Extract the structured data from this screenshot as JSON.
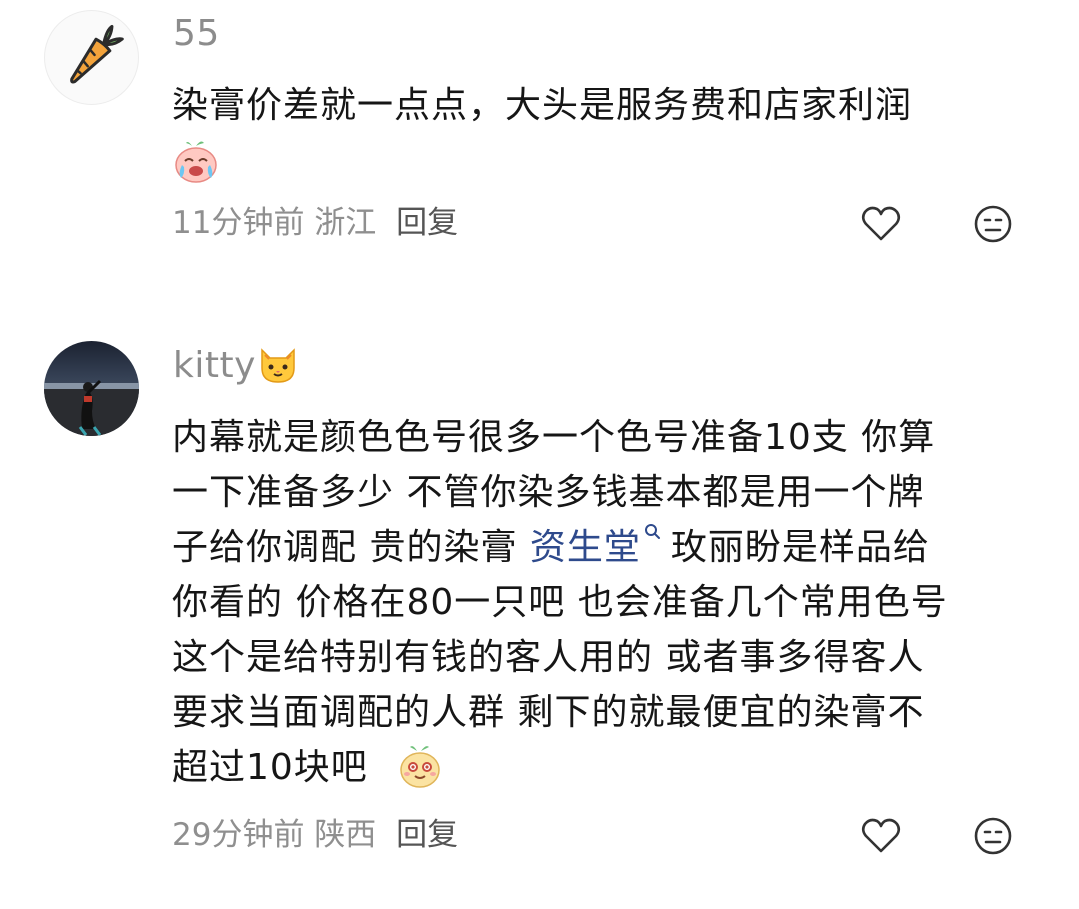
{
  "comments": [
    {
      "username": "55",
      "avatar_icon": "carrot-icon",
      "text": "染膏价差就一点点，大头是服务费和店家利润",
      "emoji": "crying-peach-emoji",
      "time": "11分钟前",
      "location": "浙江",
      "reply_label": "回复",
      "like_icon": "heart-icon",
      "dislike_icon": "meh-face-icon"
    },
    {
      "username": "kitty",
      "username_emoji": "cat-face-emoji",
      "avatar_icon": "person-photo-avatar",
      "text_lines": [
        "内幕就是颜色色号很多一个色号准备10支 你算",
        "一下准备多少 不管你染多钱基本都是用一个牌",
        "子给你调配 贵的染膏 ",
        "资生堂",
        "玫丽盼是样品给",
        "你看的 价格在80一只吧 也会准备几个常用色号",
        "这个是给特别有钱的客人用的 或者事多得客人",
        "要求当面调配的人群 剩下的就最便宜的染膏不",
        "超过10块吧 "
      ],
      "emoji": "smiling-peach-emoji",
      "time": "29分钟前",
      "location": "陕西",
      "reply_label": "回复",
      "like_icon": "heart-icon",
      "dislike_icon": "meh-face-icon",
      "link_color": "#2e4a8c"
    }
  ]
}
